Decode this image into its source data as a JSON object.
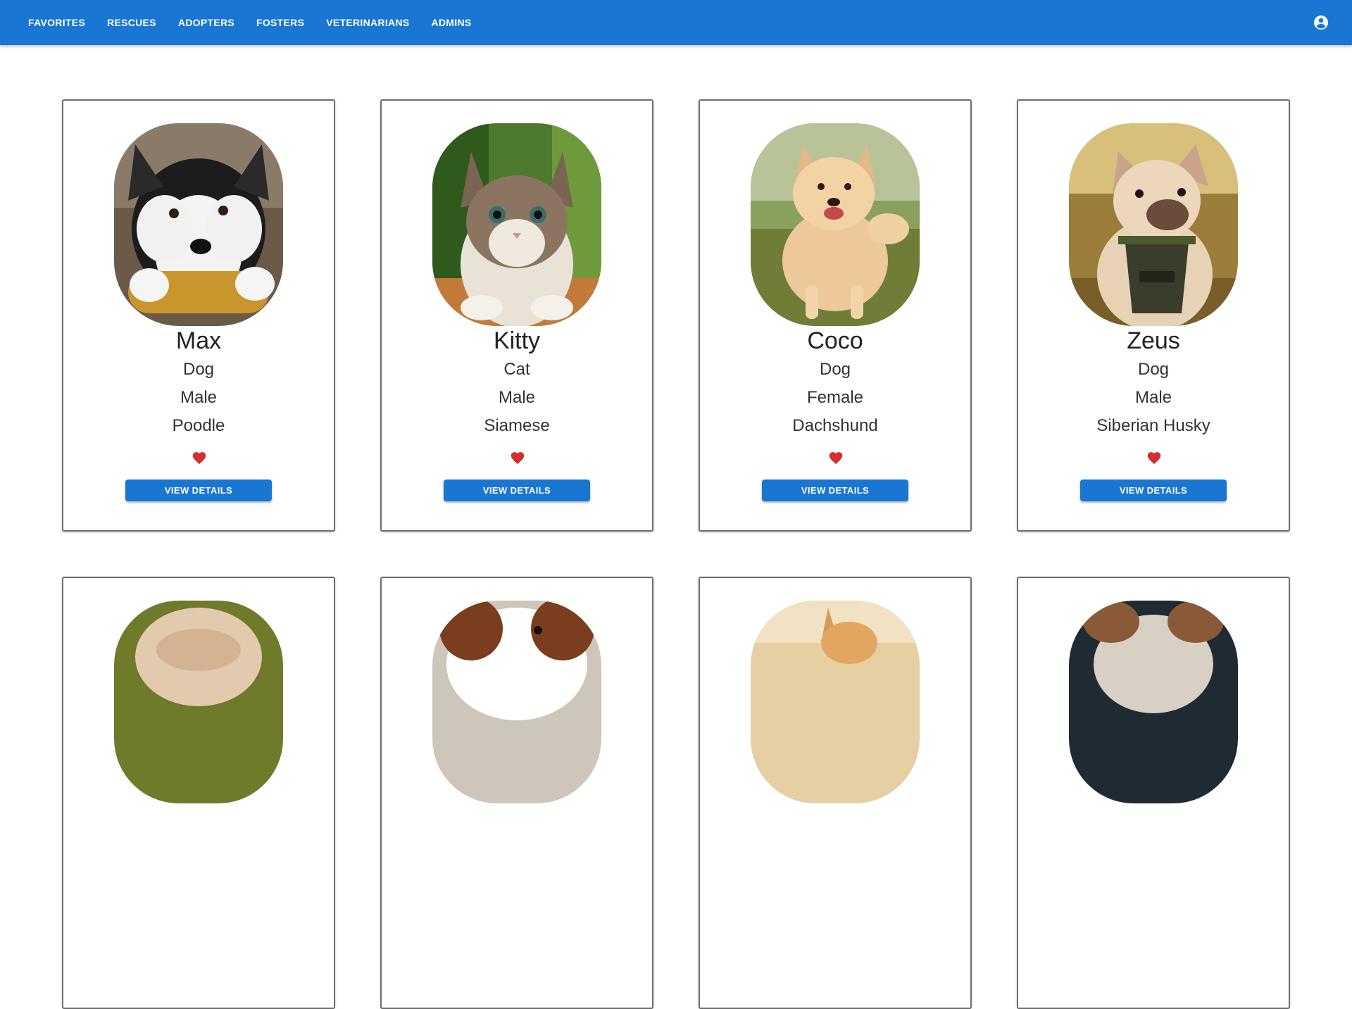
{
  "nav": {
    "items": [
      {
        "label": "FAVORITES"
      },
      {
        "label": "RESCUES"
      },
      {
        "label": "ADOPTERS"
      },
      {
        "label": "FOSTERS"
      },
      {
        "label": "VETERINARIANS"
      },
      {
        "label": "ADMINS"
      }
    ],
    "account_icon": "account-circle-icon"
  },
  "theme": {
    "primary": "#1976d2",
    "heart": "#d32f2f"
  },
  "pets": [
    {
      "name": "Max",
      "species": "Dog",
      "gender": "Male",
      "breed": "Poodle",
      "favorite": true,
      "button": "VIEW DETAILS"
    },
    {
      "name": "Kitty",
      "species": "Cat",
      "gender": "Male",
      "breed": "Siamese",
      "favorite": true,
      "button": "VIEW DETAILS"
    },
    {
      "name": "Coco",
      "species": "Dog",
      "gender": "Female",
      "breed": "Dachshund",
      "favorite": true,
      "button": "VIEW DETAILS"
    },
    {
      "name": "Zeus",
      "species": "Dog",
      "gender": "Male",
      "breed": "Siberian Husky",
      "favorite": true,
      "button": "VIEW DETAILS"
    },
    {
      "name": "",
      "species": "",
      "gender": "",
      "breed": "",
      "favorite": true,
      "button": ""
    },
    {
      "name": "",
      "species": "",
      "gender": "",
      "breed": "",
      "favorite": true,
      "button": ""
    },
    {
      "name": "",
      "species": "",
      "gender": "",
      "breed": "",
      "favorite": true,
      "button": ""
    },
    {
      "name": "",
      "species": "",
      "gender": "",
      "breed": "",
      "favorite": true,
      "button": ""
    }
  ]
}
